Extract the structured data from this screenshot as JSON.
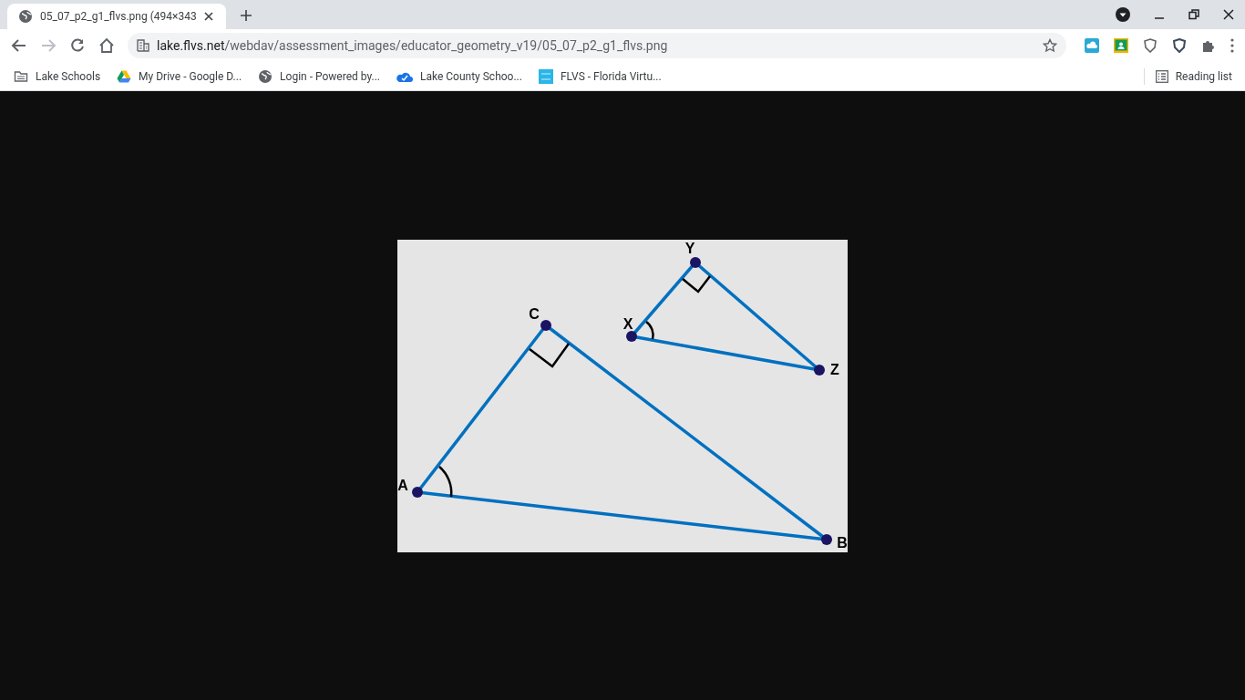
{
  "tab": {
    "title": "05_07_p2_g1_flvs.png (494×343",
    "selected": true
  },
  "address": {
    "host": "lake.flvs.net",
    "path": "/webdav/assessment_images/educator_geometry_v19/05_07_p2_g1_flvs.png"
  },
  "bookmarks": [
    {
      "kind": "folder",
      "label": "Lake Schools"
    },
    {
      "kind": "drive",
      "label": "My Drive - Google D..."
    },
    {
      "kind": "globe",
      "label": "Login - Powered by..."
    },
    {
      "kind": "cloud",
      "label": "Lake County Schoo..."
    },
    {
      "kind": "flvs",
      "label": "FLVS - Florida Virtu..."
    }
  ],
  "reading_list": "Reading list",
  "figure": {
    "vertices": [
      {
        "label": "A"
      },
      {
        "label": "C"
      },
      {
        "label": "B"
      },
      {
        "label": "X"
      },
      {
        "label": "Y"
      },
      {
        "label": "Z"
      }
    ]
  }
}
